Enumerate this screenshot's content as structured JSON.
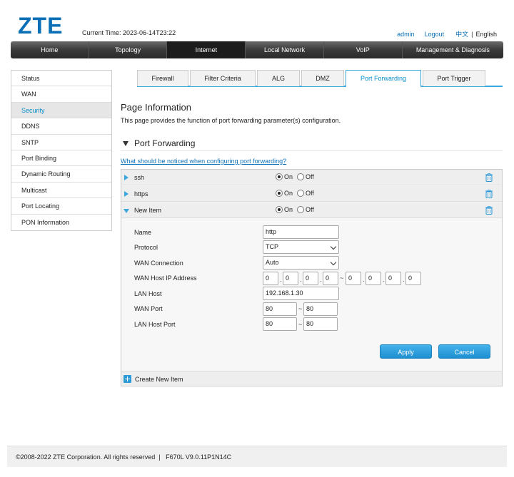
{
  "header": {
    "logo": "ZTE",
    "current_time_label": "Current Time:",
    "current_time": "2023-06-14T23:22",
    "user": "admin",
    "logout": "Logout",
    "lang_cn": "中文",
    "lang_sep": "|",
    "lang_en": "English"
  },
  "nav": [
    "Home",
    "Topology",
    "Internet",
    "Local Network",
    "VoIP",
    "Management & Diagnosis"
  ],
  "sidebar": [
    "Status",
    "WAN",
    "Security",
    "DDNS",
    "SNTP",
    "Port Binding",
    "Dynamic Routing",
    "Multicast",
    "Port Locating",
    "PON Information"
  ],
  "tabs": [
    "Firewall",
    "Filter Criteria",
    "ALG",
    "DMZ",
    "Port Forwarding",
    "Port Trigger"
  ],
  "page": {
    "title": "Page Information",
    "desc": "This page provides the function of port forwarding parameter(s) configuration.",
    "section_title": "Port Forwarding",
    "notice_link": "What should be noticed when configuring port forwarding?"
  },
  "rules": [
    {
      "name": "ssh",
      "on": "On",
      "off": "Off",
      "state": "on"
    },
    {
      "name": "https",
      "on": "On",
      "off": "Off",
      "state": "on"
    },
    {
      "name": "New Item",
      "on": "On",
      "off": "Off",
      "state": "on"
    }
  ],
  "form": {
    "labels": {
      "name": "Name",
      "protocol": "Protocol",
      "wan_connection": "WAN Connection",
      "wan_host_ip": "WAN Host IP Address",
      "lan_host": "LAN Host",
      "wan_port": "WAN Port",
      "lan_host_port": "LAN Host Port"
    },
    "name": "http",
    "protocol": "TCP",
    "wan_connection": "Auto",
    "wan_ip_start": [
      "0",
      "0",
      "0",
      "0"
    ],
    "wan_ip_end": [
      "0",
      "0",
      "0",
      "0"
    ],
    "ip_dot": ".",
    "range_sep": "~",
    "lan_host": "192.168.1.30",
    "wan_port_start": "80",
    "wan_port_end": "80",
    "lan_port_start": "80",
    "lan_port_end": "80",
    "apply": "Apply",
    "cancel": "Cancel"
  },
  "create_new": "Create New Item",
  "footer": "©2008-2022 ZTE Corporation. All rights reserved  |   F670L V9.0.11P1N14C",
  "colors": {
    "accent": "#3ba7dc",
    "link": "#0a6fb5",
    "button": "#1d8fd1"
  },
  "icons": {
    "delete": "trash-icon",
    "expand": "triangle-right-icon",
    "collapse": "triangle-down-icon",
    "add": "plus-icon"
  }
}
